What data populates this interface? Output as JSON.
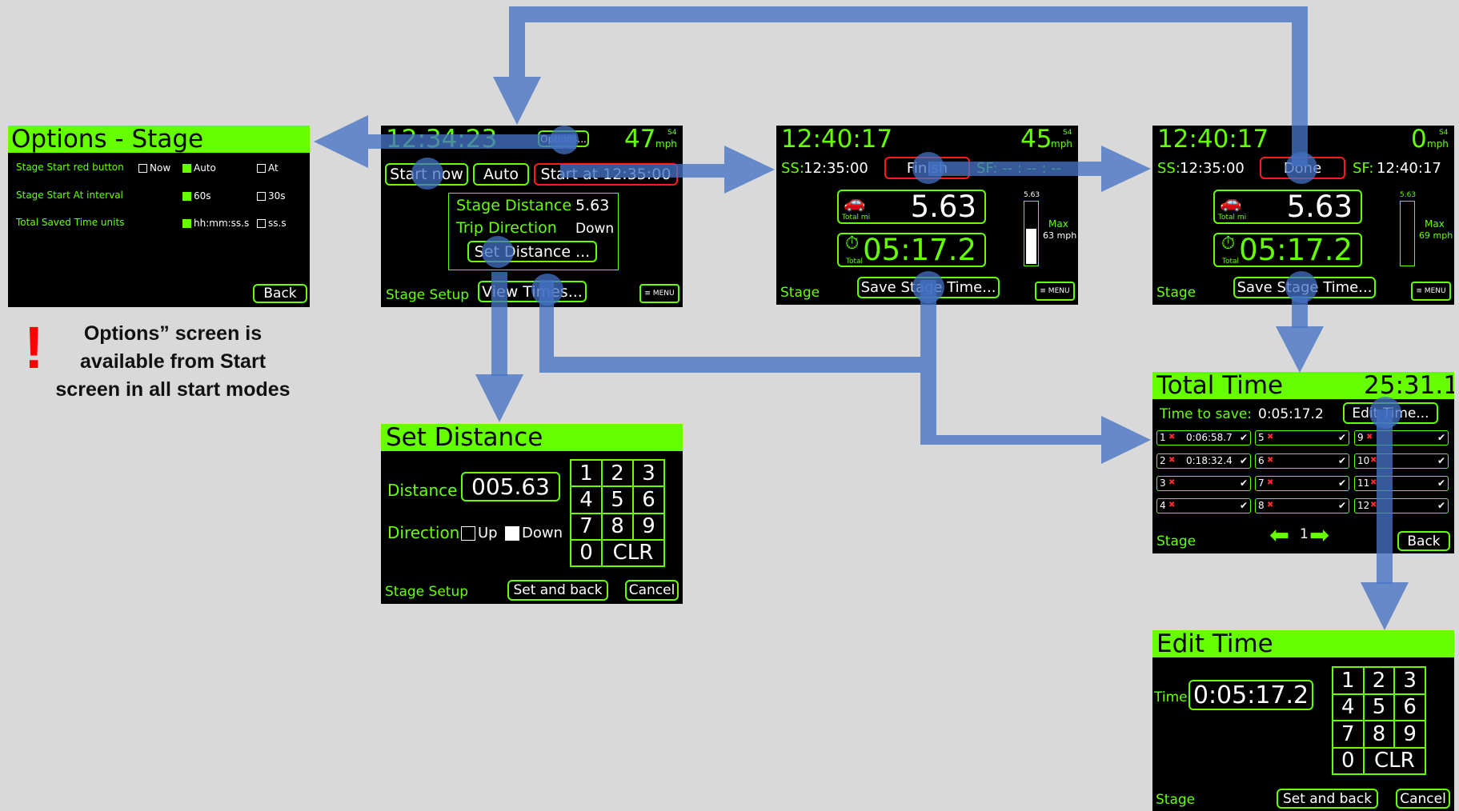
{
  "options_screen": {
    "title": "Options - Stage",
    "rows": [
      {
        "label": "Stage Start red button",
        "opts": [
          {
            "text": "Now",
            "checked": false
          },
          {
            "text": "Auto",
            "checked": true
          },
          {
            "text": "At",
            "checked": false
          }
        ]
      },
      {
        "label": "Stage Start At interval",
        "opts": [
          {
            "text": "60s",
            "checked": true
          },
          {
            "text": "30s",
            "checked": false
          }
        ]
      },
      {
        "label": "Total Saved Time units",
        "opts": [
          {
            "text": "hh:mm:ss.s",
            "checked": true
          },
          {
            "text": "ss.s",
            "checked": false
          }
        ]
      }
    ],
    "back": "Back"
  },
  "note": {
    "mark": "!",
    "text": "Options” screen is available from Start screen in all start modes"
  },
  "setup_screen": {
    "time": "12:34:23",
    "options": "Options...",
    "speed": "47",
    "speed_unit": "mph",
    "sat": "S4",
    "start_now": "Start now",
    "auto": "Auto",
    "start_at": "Start at 12:35:00",
    "stage_distance_label": "Stage Distance",
    "stage_distance": "5.63",
    "trip_direction_label": "Trip Direction",
    "trip_direction": "Down",
    "set_distance": "Set Distance ...",
    "footer": "Stage Setup",
    "view_times": "View Times...",
    "menu": "≡ MENU"
  },
  "stage_running": {
    "time": "12:40:17",
    "speed": "45",
    "speed_unit": "mph",
    "sat": "S4",
    "ss_label": "SS:",
    "ss": "12:35:00",
    "action": "Finish",
    "sf": "SF: -- : -- : --",
    "distance": "5.63",
    "distance_caption": "Total mi",
    "elapsed": "05:17.2",
    "elapsed_caption": "Total",
    "bar_top": "5.63",
    "max_label": "Max",
    "max_speed": "63 mph",
    "bar_level": 0.55,
    "footer": "Stage",
    "save": "Save Stage Time...",
    "menu": "≡ MENU"
  },
  "stage_done": {
    "time": "12:40:17",
    "speed": "0",
    "speed_unit": "mph",
    "sat": "S4",
    "ss_label": "SS:",
    "ss": "12:35:00",
    "action": "Done",
    "sf_label": "SF:",
    "sf": "12:40:17",
    "distance": "5.63",
    "distance_caption": "Total mi",
    "elapsed": "05:17.2",
    "elapsed_caption": "Total",
    "bar_top": "5.63",
    "max_label": "Max",
    "max_speed": "69 mph",
    "bar_level": 0,
    "footer": "Stage",
    "save": "Save Stage Time...",
    "menu": "≡ MENU"
  },
  "set_distance_screen": {
    "title": "Set Distance",
    "distance_label": "Distance",
    "distance": "005.63",
    "direction_label": "Direction",
    "up": "Up",
    "down": "Down",
    "up_checked": false,
    "down_checked": true,
    "keys": [
      "1",
      "2",
      "3",
      "4",
      "5",
      "6",
      "7",
      "8",
      "9",
      "0",
      "CLR"
    ],
    "footer": "Stage Setup",
    "set_back": "Set and back",
    "cancel": "Cancel"
  },
  "total_time_screen": {
    "title": "Total Time",
    "total": "25:31.1",
    "save_label": "Time to save:",
    "save_value": "0:05:17.2",
    "edit": "Edit Time...",
    "slots": [
      {
        "n": "1",
        "time": "0:06:58.7"
      },
      {
        "n": "5",
        "time": ""
      },
      {
        "n": "9",
        "time": ""
      },
      {
        "n": "2",
        "time": "0:18:32.4"
      },
      {
        "n": "6",
        "time": ""
      },
      {
        "n": "10",
        "time": ""
      },
      {
        "n": "3",
        "time": ""
      },
      {
        "n": "7",
        "time": ""
      },
      {
        "n": "11",
        "time": ""
      },
      {
        "n": "4",
        "time": ""
      },
      {
        "n": "8",
        "time": ""
      },
      {
        "n": "12",
        "time": ""
      }
    ],
    "page": "1",
    "footer": "Stage",
    "back": "Back"
  },
  "edit_time_screen": {
    "title": "Edit Time",
    "time_label": "Time",
    "time": "0:05:17.2",
    "keys": [
      "1",
      "2",
      "3",
      "4",
      "5",
      "6",
      "7",
      "8",
      "9",
      "0",
      "CLR"
    ],
    "footer": "Stage",
    "set_back": "Set and back",
    "cancel": "Cancel"
  },
  "colors": {
    "screen_green": "#66ff00",
    "arrow_blue": "#4472c4",
    "alert_red": "#ff0000",
    "finish_red": "#ff1a1a"
  }
}
